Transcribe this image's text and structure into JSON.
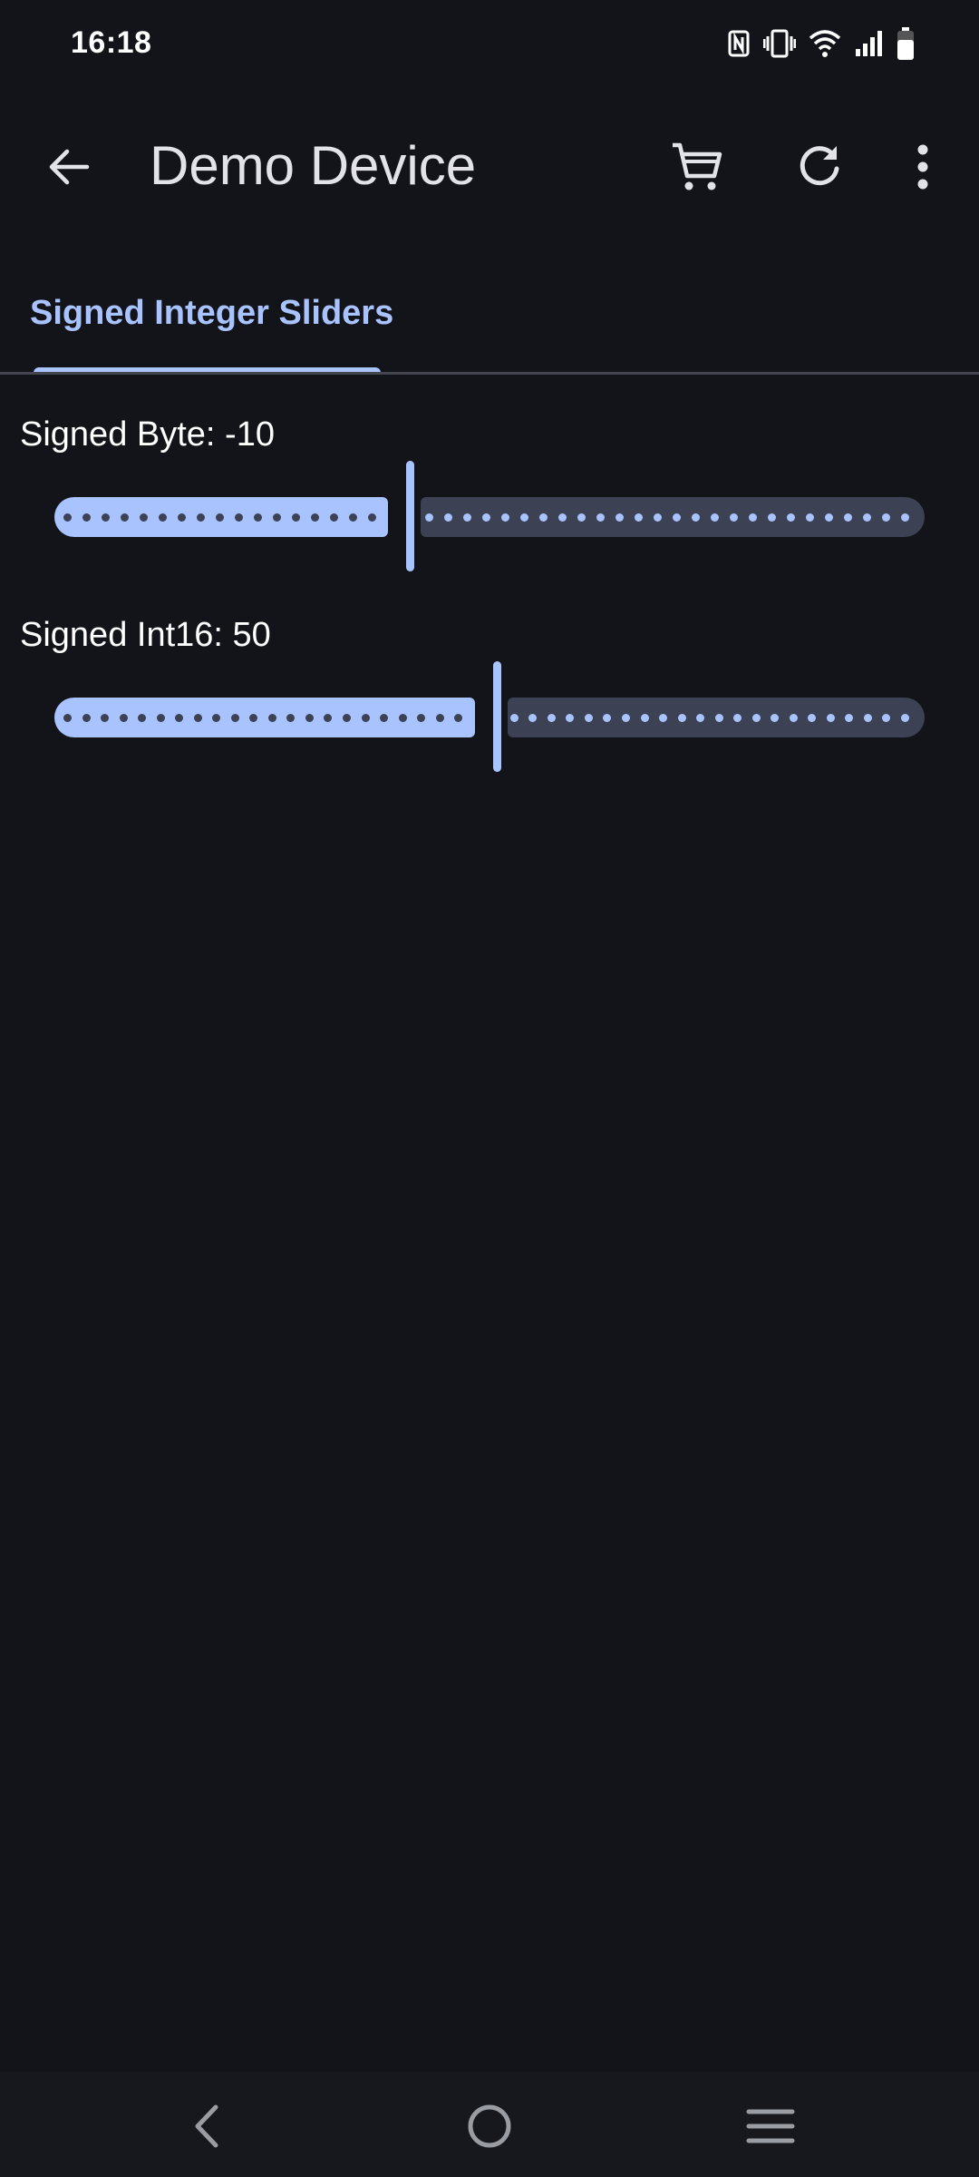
{
  "status_bar": {
    "time": "16:18",
    "icons": [
      "nfc-icon",
      "vibrate-icon",
      "wifi-icon",
      "signal-icon",
      "battery-icon"
    ]
  },
  "app_bar": {
    "title": "Demo Device",
    "actions": [
      "cart-icon",
      "refresh-icon",
      "more-vert-icon"
    ]
  },
  "tabs": [
    {
      "label": "Signed Integer Sliders",
      "selected": true
    }
  ],
  "sliders": [
    {
      "label_prefix": "Signed Byte: ",
      "value": "-10",
      "fraction": 0.4,
      "tick_count": 45
    },
    {
      "label_prefix": "Signed Int16: ",
      "value": "50",
      "fraction": 0.5,
      "tick_count": 46
    }
  ],
  "colors": {
    "background": "#131419",
    "accent": "#a9c3ff",
    "track_inactive": "#3c4154",
    "tick_on_active": "#3c4154",
    "tick_on_inactive": "#a9c3ff"
  }
}
